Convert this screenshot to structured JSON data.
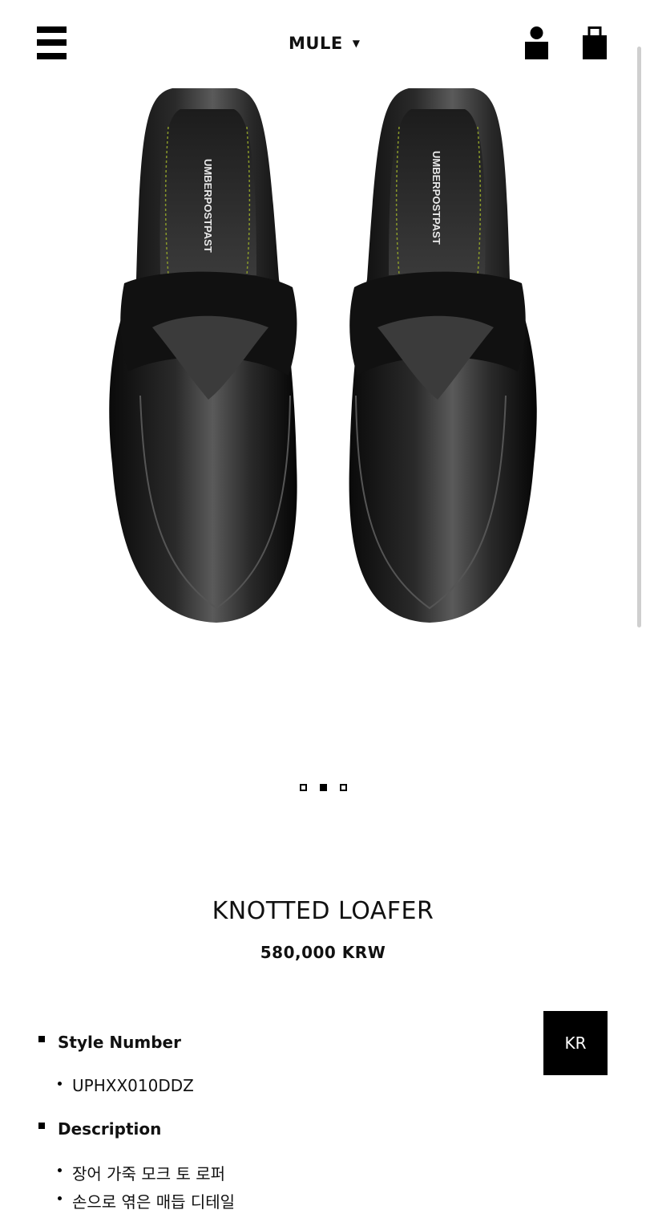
{
  "header": {
    "category_label": "MULE",
    "menu_icon": "hamburger-menu-icon",
    "account_icon": "user-icon",
    "cart_icon": "shopping-bag-icon"
  },
  "product": {
    "image": {
      "alt": "KNOTTED LOAFER",
      "insole_brand_text": "UMBERPOSTPAST"
    },
    "carousel": {
      "count": 3,
      "active_index": 1
    },
    "title": "KNOTTED LOAFER",
    "price": "580,000 KRW"
  },
  "language_button": "KR",
  "details": {
    "style_number_label": "Style Number",
    "style_number_value": "UPHXX010DDZ",
    "description_label": "Description",
    "description_items": [
      "장어 가죽 모크 토 로퍼",
      "손으로 엮은 매듭 디테일"
    ]
  },
  "colors": {
    "accent": "#000000",
    "background": "#ffffff",
    "scrollbar": "#cfcfcf"
  }
}
